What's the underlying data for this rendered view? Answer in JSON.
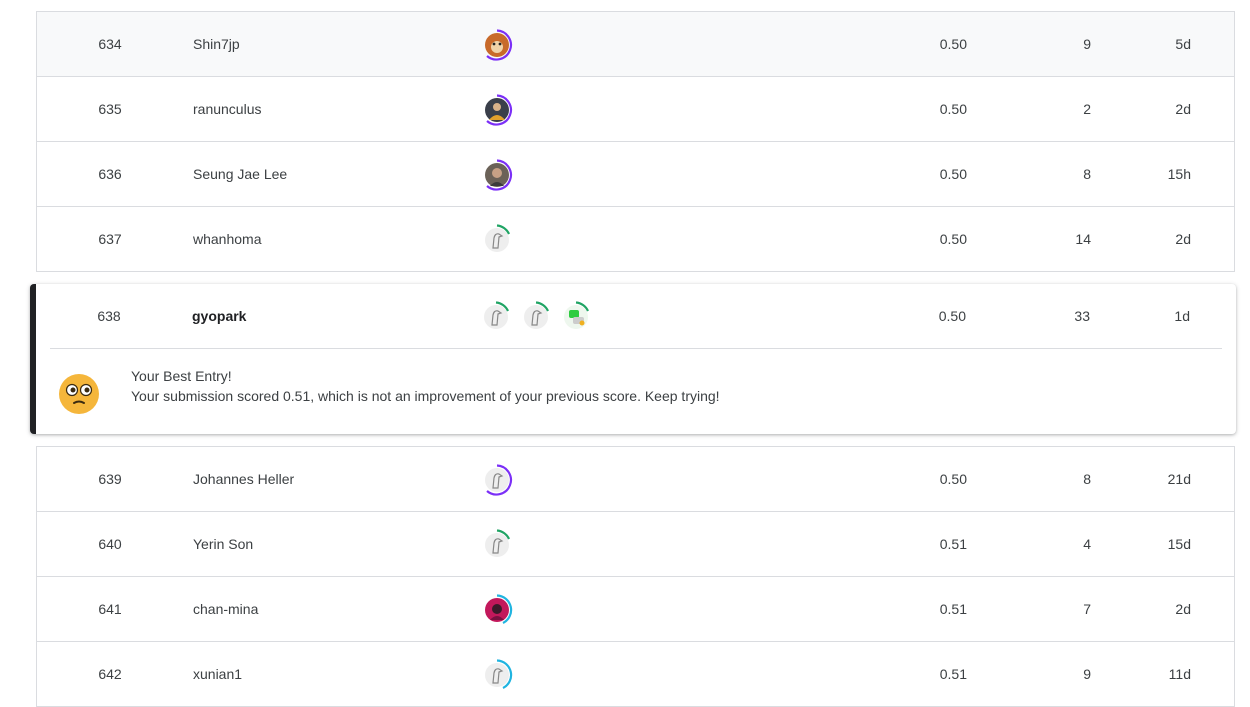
{
  "colors": {
    "ring_purple": "#7b2ff7",
    "ring_green": "#20a464",
    "ring_blue": "#20b4e0",
    "accent_dark": "#202124"
  },
  "rows_top": [
    {
      "rank": "634",
      "name": "Shin7jp",
      "score": "0.50",
      "entries": "9",
      "last": "5d",
      "avatar": "fox-avatar",
      "ring": "purple"
    },
    {
      "rank": "635",
      "name": "ranunculus",
      "score": "0.50",
      "entries": "2",
      "last": "2d",
      "avatar": "person-avatar",
      "ring": "purple"
    },
    {
      "rank": "636",
      "name": "Seung Jae Lee",
      "score": "0.50",
      "entries": "8",
      "last": "15h",
      "avatar": "person-avatar",
      "ring": "purple"
    },
    {
      "rank": "637",
      "name": "whanhoma",
      "score": "0.50",
      "entries": "14",
      "last": "2d",
      "avatar": "default-avatar",
      "ring": "green"
    }
  ],
  "my_row": {
    "rank": "638",
    "name": "gyopark",
    "score": "0.50",
    "entries": "33",
    "last": "1d",
    "team": [
      "default-avatar",
      "default-avatar",
      "green-logo-avatar"
    ],
    "message_title": "Your Best Entry!",
    "message_body": "Your submission scored 0.51, which is not an improvement of your previous score. Keep trying!",
    "emoji": "flushed-face-emoji"
  },
  "rows_bottom": [
    {
      "rank": "639",
      "name": "Johannes Heller",
      "score": "0.50",
      "entries": "8",
      "last": "21d",
      "avatar": "default-avatar",
      "ring": "purple"
    },
    {
      "rank": "640",
      "name": "Yerin Son",
      "score": "0.51",
      "entries": "4",
      "last": "15d",
      "avatar": "default-avatar",
      "ring": "green"
    },
    {
      "rank": "641",
      "name": "chan-mina",
      "score": "0.51",
      "entries": "7",
      "last": "2d",
      "avatar": "pink-avatar",
      "ring": "blue"
    },
    {
      "rank": "642",
      "name": "xunian1",
      "score": "0.51",
      "entries": "9",
      "last": "11d",
      "avatar": "default-avatar",
      "ring": "blue"
    }
  ]
}
